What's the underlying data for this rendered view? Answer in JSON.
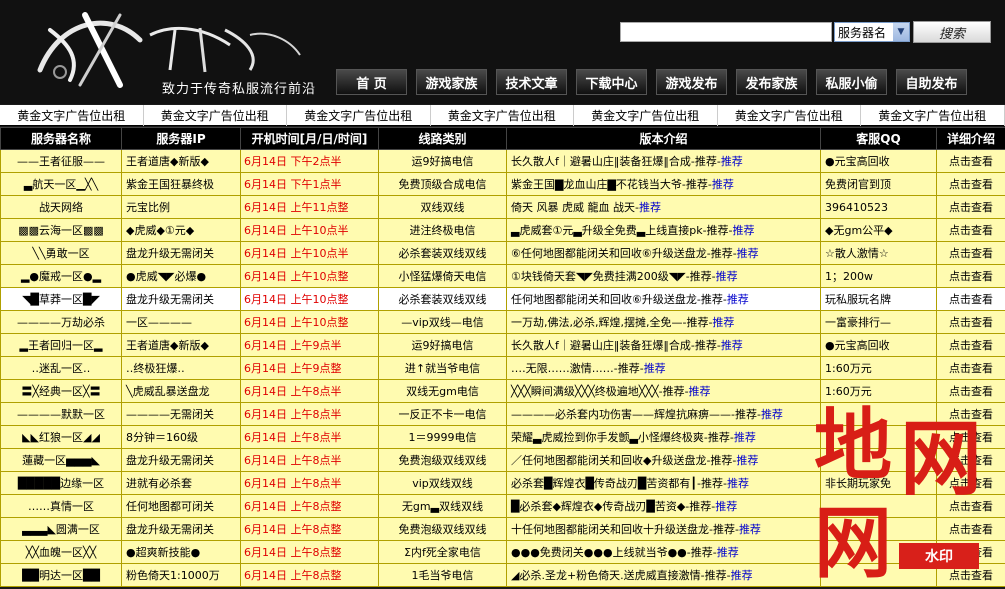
{
  "header": {
    "logo_text": "传奇百游",
    "tagline": "致力于传奇私服流行前沿",
    "search": {
      "value": "",
      "placeholder": "",
      "select_label": "服务器名",
      "button_label": "搜索"
    }
  },
  "nav": [
    "首 页",
    "游戏家族",
    "技术文章",
    "下载中心",
    "游戏发布",
    "发布家族",
    "私服小偷",
    "自助发布"
  ],
  "ads": [
    "黄金文字广告位出租",
    "黄金文字广告位出租",
    "黄金文字广告位出租",
    "黄金文字广告位出租",
    "黄金文字广告位出租",
    "黄金文字广告位出租",
    "黄金文字广告位出租"
  ],
  "table": {
    "headers": [
      "服务器名称",
      "服务器IP",
      "开机时间[月/日/时间]",
      "线路类别",
      "版本介绍",
      "客服QQ",
      "详细介绍"
    ],
    "rows": [
      {
        "name": "——王者征服——",
        "ip": "王者道唐◆新版◆",
        "time": "6月14日 下午2点半",
        "line": "运9好搞电信",
        "desc": "长久散人f｜避暑山庄‖装备狂爆‖合成-推荐-",
        "rec": "推荐",
        "qq": "●元宝高回收",
        "detail": "点击查看"
      },
      {
        "name": "▃航天一区▁╳╲",
        "ip": "紫金王国狂暴终极",
        "time": "6月14日 下午1点半",
        "line": "免费顶级合成电信",
        "desc": "紫金王国▇龙血山庄▇不花钱当大爷-推荐-",
        "rec": "推荐",
        "qq": "免费闭官到顶",
        "detail": "点击查看"
      },
      {
        "name": "战天网络",
        "ip": "元宝比例",
        "time": "6月14日 上午11点整",
        "line": "双线双线",
        "desc": "倚天 风暴 虎威 龍血 战天-",
        "rec": "推荐",
        "qq": "396410523",
        "detail": "点击查看"
      },
      {
        "name": "▩▩云海一区▩▩",
        "ip": "◆虎威◆①元◆",
        "time": "6月14日 上午10点半",
        "line": "进注终极电信",
        "desc": "▃虎威套①元▃升级全免费▃上线直接pk-推荐-",
        "rec": "推荐",
        "qq": "◆无gm公平◆",
        "detail": "点击查看"
      },
      {
        "name": "╲╲勇敢一区",
        "ip": "盘龙升级无需闭关",
        "time": "6月14日 上午10点半",
        "line": "必杀套装双线双线",
        "desc": "⑥任何地图都能闭关和回收⑥升级送盘龙-推荐-",
        "rec": "推荐",
        "qq": "☆散人激情☆",
        "detail": "点击查看"
      },
      {
        "name": "▂●魔戒一区●▂",
        "ip": "●虎威◥◤必爆●",
        "time": "6月14日 上午10点整",
        "line": "小怪猛爆倚天电信",
        "desc": "①块钱倚天套◥◤免费挂满200级◥◤-推荐-",
        "rec": "推荐",
        "qq": "1；200w",
        "detail": "点击查看"
      },
      {
        "name": "◥█草莽一区█◤",
        "ip": "盘龙升级无需闭关",
        "time": "6月14日 上午10点整",
        "line": "必杀套装双线双线",
        "desc": "任何地图都能闭关和回收⑥升级送盘龙-推荐-",
        "rec": "推荐",
        "qq": "玩私服玩名牌",
        "detail": "点击查看",
        "white": true
      },
      {
        "name": "————万劫必杀",
        "ip": "一区————",
        "time": "6月14日 上午10点整",
        "line": "—vip双线—电信",
        "desc": "一万劫,佛法,必杀,辉煌,摆摊,全免—-推荐-",
        "rec": "推荐",
        "qq": "一富豪排行—",
        "detail": "点击查看"
      },
      {
        "name": "▂王者回归一区▂",
        "ip": "王者道唐◆新版◆",
        "time": "6月14日 上午9点半",
        "line": "运9好搞电信",
        "desc": "长久散人f｜避暑山庄‖装备狂爆‖合成-推荐-",
        "rec": "推荐",
        "qq": "●元宝高回收",
        "detail": "点击查看"
      },
      {
        "name": "‥迷乱一区‥",
        "ip": "‥终极狂爆‥",
        "time": "6月14日 上午9点整",
        "line": "进↑就当爷电信",
        "desc": "‥‥无限‥‥‥激情‥‥‥-推荐-",
        "rec": "推荐",
        "qq": "1:60万元",
        "detail": "点击查看"
      },
      {
        "name": "〓╳经典一区╳〓",
        "ip": "╲虎威乱暴送盘龙",
        "time": "6月14日 上午8点半",
        "line": "双线无gm电信",
        "desc": "╳╳╳瞬间满级╳╳╳终极遍地╳╳╳-推荐-",
        "rec": "推荐",
        "qq": "1:60万元",
        "detail": "点击查看"
      },
      {
        "name": "————默默一区",
        "ip": "————无需闭关",
        "time": "6月14日 上午8点半",
        "line": "一反正不卡一电信",
        "desc": "————必杀套内功伤害——辉煌抗麻痹——-推荐-",
        "rec": "推荐",
        "qq": "",
        "detail": "点击查看"
      },
      {
        "name": "◣◣红狼一区◢◢",
        "ip": "8分钟＝160级",
        "time": "6月14日 上午8点半",
        "line": "1＝9999电信",
        "desc": "荣耀▃虎威捡到你手发颤▃小怪爆终极爽-推荐-",
        "rec": "推荐",
        "qq": "",
        "detail": "点击查看"
      },
      {
        "name": "蓮藏一区▅▅▅◣",
        "ip": "盘龙升级无需闭关",
        "time": "6月14日 上午8点半",
        "line": "免费泡级双线双线",
        "desc": "／任何地图都能闭关和回收◆升级送盘龙-推荐-",
        "rec": "推荐",
        "qq": "",
        "detail": "点击查看"
      },
      {
        "name": "█████边缘一区",
        "ip": "进就有必杀套",
        "time": "6月14日 上午8点半",
        "line": "vip双线双线",
        "desc": "必杀套█辉煌衣█传奇战刃█苦资都有┃-推荐-",
        "rec": "推荐",
        "qq": "非长期玩家免",
        "detail": "点击查看"
      },
      {
        "name": "‥‥‥真情一区",
        "ip": "任何地图都可闭关",
        "time": "6月14日 上午8点整",
        "line": "无gm▃双线双线",
        "desc": "█必杀套◆辉煌衣◆传奇战刃█苦资◆-推荐-",
        "rec": "推荐",
        "qq": "",
        "detail": "点击查看"
      },
      {
        "name": "▃▃▃◣圆满一区",
        "ip": "盘龙升级无需闭关",
        "time": "6月14日 上午8点整",
        "line": "免费泡级双线双线",
        "desc": "十任何地图都能闭关和回收十升级送盘龙-推荐-",
        "rec": "推荐",
        "qq": "",
        "detail": "点击查看"
      },
      {
        "name": "╳╳血魄一区╳╳",
        "ip": "●超爽新技能●",
        "time": "6月14日 上午8点整",
        "line": "Σ内f死全家电信",
        "desc": "●●●免费闭关●●●上线就当爷●●-推荐-",
        "rec": "推荐",
        "qq": "",
        "detail": "点击查看"
      },
      {
        "name": "██明达一区██",
        "ip": "粉色倚天1:1000万",
        "time": "6月14日 上午8点整",
        "line": "1毛当爷电信",
        "desc": "◢必杀.圣龙+粉色倚天.送虎威直接激情-推荐-",
        "rec": "推荐",
        "qq": "",
        "detail": "点击查看"
      }
    ]
  },
  "watermark": {
    "glyphs": "地网网",
    "label": "水印"
  }
}
